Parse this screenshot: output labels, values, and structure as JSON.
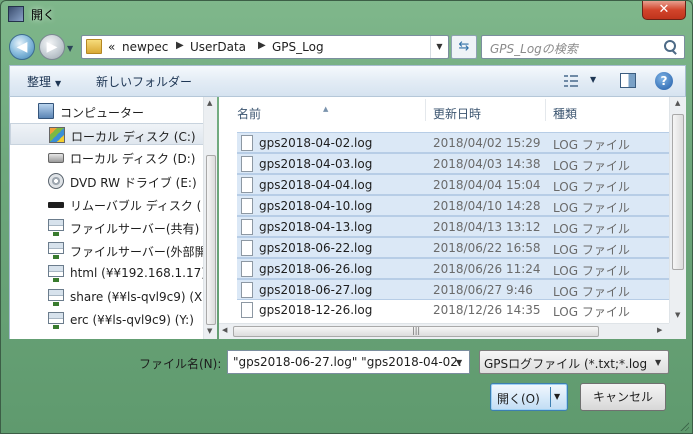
{
  "window": {
    "title": "開く",
    "close_label": "✕"
  },
  "nav": {
    "back_label": "◀",
    "forward_label": "▶",
    "breadcrumb_prefix": "«",
    "breadcrumb": [
      "newpec",
      "UserData",
      "GPS_Log"
    ],
    "refresh_label": "⇆",
    "search_placeholder": "GPS_Logの検索"
  },
  "toolbar": {
    "organize_label": "整理",
    "new_folder_label": "新しいフォルダー",
    "help_label": "?"
  },
  "tree": [
    {
      "label": "コンピューター",
      "icon": "computer-icon",
      "indent": 0,
      "selected": false
    },
    {
      "label": "ローカル ディスク (C:)",
      "icon": "system-drive-icon",
      "indent": 1,
      "selected": true
    },
    {
      "label": "ローカル ディスク (D:)",
      "icon": "drive-icon",
      "indent": 1,
      "selected": false
    },
    {
      "label": "DVD RW ドライブ (E:) ",
      "icon": "dvd-icon",
      "indent": 1,
      "selected": false
    },
    {
      "label": "リムーバブル ディスク (",
      "icon": "usb-drive-icon",
      "indent": 1,
      "selected": false
    },
    {
      "label": "ファイルサーバー(共有)",
      "icon": "network-drive-icon",
      "indent": 1,
      "selected": false
    },
    {
      "label": "ファイルサーバー(外部開",
      "icon": "network-drive-icon",
      "indent": 1,
      "selected": false
    },
    {
      "label": "html (¥¥192.168.1.17)",
      "icon": "network-drive-icon",
      "indent": 1,
      "selected": false
    },
    {
      "label": "share (¥¥ls-qvl9c9) (X:",
      "icon": "network-drive-icon",
      "indent": 1,
      "selected": false
    },
    {
      "label": "erc (¥¥ls-qvl9c9) (Y:)",
      "icon": "network-drive-icon",
      "indent": 1,
      "selected": false
    }
  ],
  "columns": {
    "name": "名前",
    "date": "更新日時",
    "type": "種類"
  },
  "files": [
    {
      "name": "gps2018-04-02.log",
      "date": "2018/04/02 15:29",
      "type": "LOG ファイル",
      "selected": true
    },
    {
      "name": "gps2018-04-03.log",
      "date": "2018/04/03 14:38",
      "type": "LOG ファイル",
      "selected": true
    },
    {
      "name": "gps2018-04-04.log",
      "date": "2018/04/04 15:04",
      "type": "LOG ファイル",
      "selected": true
    },
    {
      "name": "gps2018-04-10.log",
      "date": "2018/04/10 14:28",
      "type": "LOG ファイル",
      "selected": true
    },
    {
      "name": "gps2018-04-13.log",
      "date": "2018/04/13 13:12",
      "type": "LOG ファイル",
      "selected": true
    },
    {
      "name": "gps2018-06-22.log",
      "date": "2018/06/22 16:58",
      "type": "LOG ファイル",
      "selected": true
    },
    {
      "name": "gps2018-06-26.log",
      "date": "2018/06/26 11:24",
      "type": "LOG ファイル",
      "selected": true
    },
    {
      "name": "gps2018-06-27.log",
      "date": "2018/06/27 9:46",
      "type": "LOG ファイル",
      "selected": true
    },
    {
      "name": "gps2018-12-26.log",
      "date": "2018/12/26 14:35",
      "type": "LOG ファイル",
      "selected": false
    }
  ],
  "bottom": {
    "filename_label": "ファイル名(N):",
    "filename_value": "\"gps2018-06-27.log\" \"gps2018-04-02.",
    "filetype_value": "GPSログファイル (*.txt;*.log",
    "open_label": "開く(O)",
    "cancel_label": "キャンセル"
  }
}
